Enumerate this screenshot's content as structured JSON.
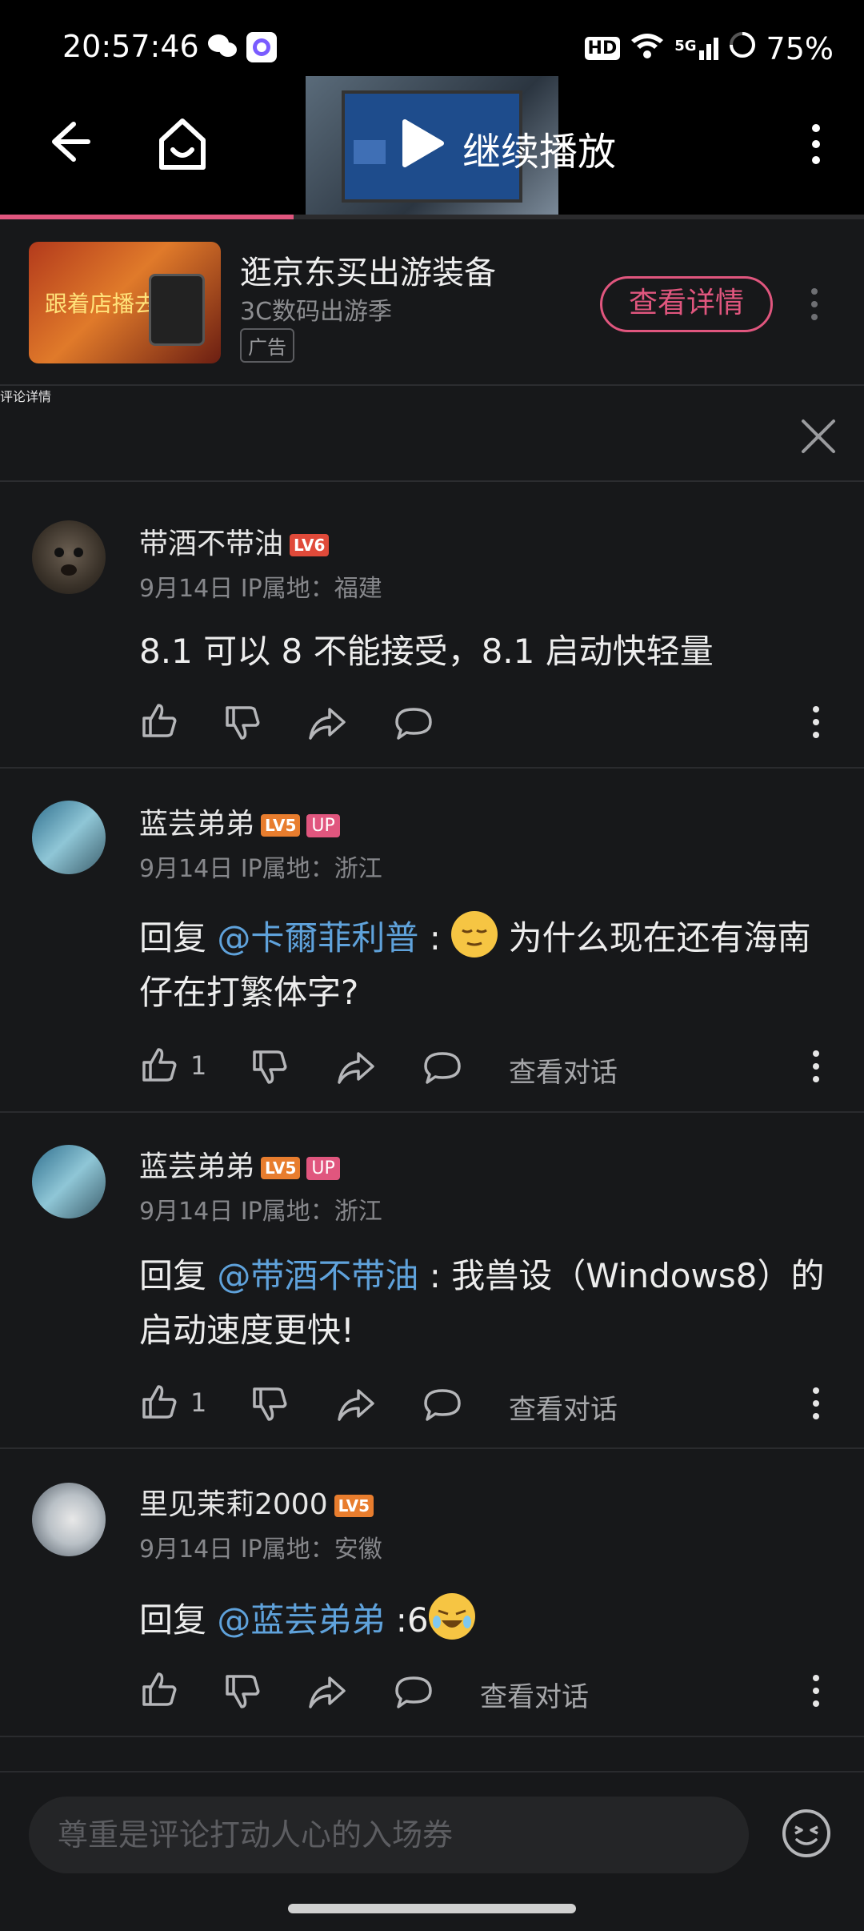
{
  "status": {
    "time": "20:57:46",
    "battery": "75%",
    "network": "5G",
    "hd": "HD"
  },
  "topbar": {
    "play_label": "继续播放",
    "progress_fraction": 0.34
  },
  "ad": {
    "title": "逛京东买出游装备",
    "subtitle": "3C数码出游季",
    "tag": "广告",
    "button": "查看详情",
    "image_text": "跟着店播去出行"
  },
  "comments_header": {
    "title": "评论详情"
  },
  "comments": [
    {
      "user": "带酒不带油",
      "level": "LV6",
      "meta": "9月14日 IP属地：福建",
      "body": "8.1 可以 8 不能接受，8.1 启动快轻量"
    },
    {
      "user": "蓝芸弟弟",
      "level": "LV5",
      "badge": "UP",
      "meta": "9月14日 IP属地：浙江",
      "reply_prefix": "回复 ",
      "mention": "@卡爾菲利普",
      "sep": " : ",
      "body": " 为什么现在还有海南仔在打繁体字?",
      "likes": "1",
      "view_conv": "查看对话"
    },
    {
      "user": "蓝芸弟弟",
      "level": "LV5",
      "badge": "UP",
      "meta": "9月14日 IP属地：浙江",
      "reply_prefix": "回复 ",
      "mention": "@带酒不带油",
      "sep": " : ",
      "body": "我兽设（Windows8）的启动速度更快!",
      "likes": "1",
      "view_conv": "查看对话"
    },
    {
      "user": "里见茉莉2000",
      "level": "LV5",
      "meta": "9月14日 IP属地：安徽",
      "reply_prefix": "回复 ",
      "mention": "@蓝芸弟弟",
      "sep": " :",
      "body": "6",
      "view_conv": "查看对话"
    }
  ],
  "input": {
    "placeholder": "尊重是评论打动人心的入场券"
  }
}
